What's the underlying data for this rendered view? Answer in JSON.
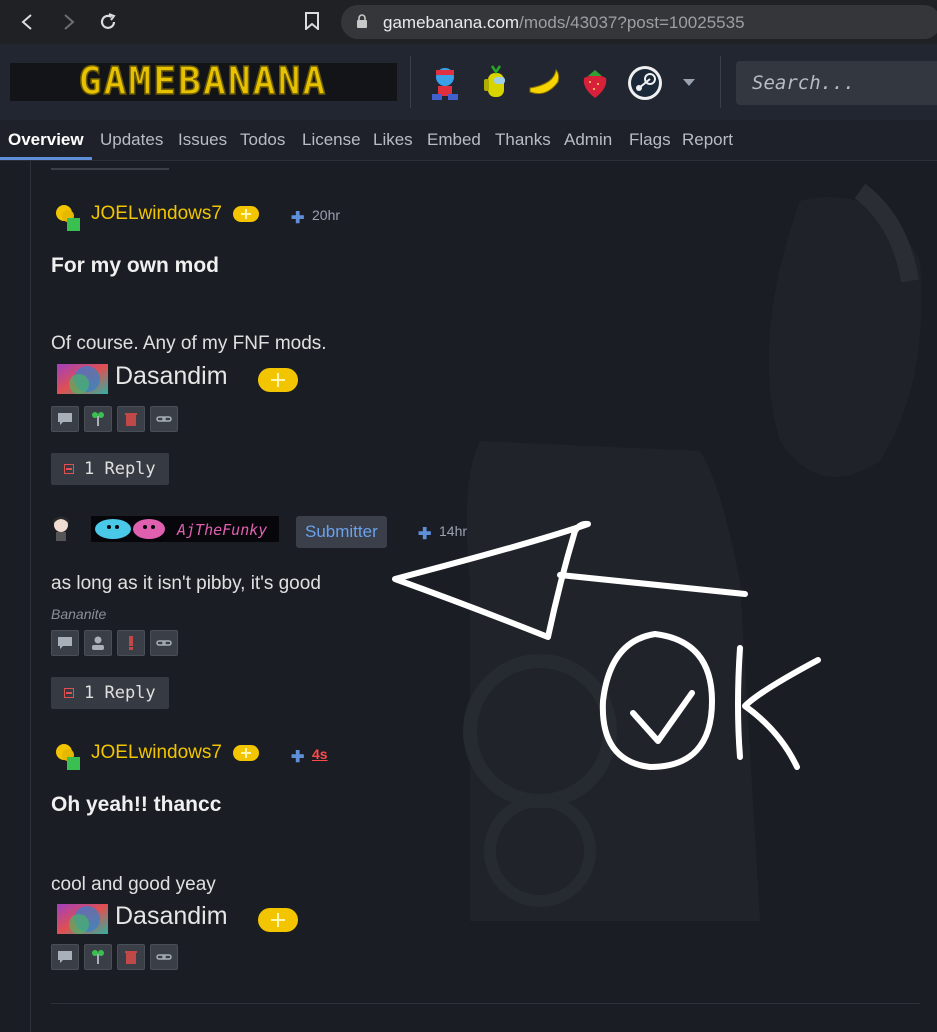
{
  "browser": {
    "url_host": "gamebanana.com",
    "url_path": "/mods/43037?post=10025535"
  },
  "site": {
    "logo_text": "GAMEBANANA",
    "game_icons": [
      "fnf-boyfriend-icon",
      "among-us-icon",
      "banana-icon",
      "strawberry-icon",
      "steam-icon"
    ],
    "search_placeholder": "Search..."
  },
  "tabs": [
    {
      "label": "Overview",
      "active": true
    },
    {
      "label": "Updates"
    },
    {
      "label": "Issues"
    },
    {
      "label": "Todos"
    },
    {
      "label": "License"
    },
    {
      "label": "Likes"
    },
    {
      "label": "Embed"
    },
    {
      "label": "Thanks"
    },
    {
      "label": "Admin"
    },
    {
      "label": "Flags"
    },
    {
      "label": "Report"
    }
  ],
  "posts": [
    {
      "username": "JOELwindows7",
      "time": "20hr",
      "title": "For my own mod",
      "body": "Of course. Any of my FNF mods.",
      "signature": "Dasandim",
      "reply_label": "1 Reply"
    },
    {
      "username": "AjTheFunky",
      "badge": "Submitter",
      "time": "14hr",
      "body": "as long as it isn't pibby, it's good",
      "rank": "Bananite",
      "reply_label": "1 Reply"
    },
    {
      "username": "JOELwindows7",
      "time": "4s",
      "title": "Oh yeah!! thancc",
      "body": "cool and good yeay",
      "signature": "Dasandim"
    }
  ],
  "colors": {
    "accent": "#5e8fd8",
    "username": "#f2c500",
    "new_time": "#ff4a4a"
  },
  "annotation": {
    "handwritten_text": "OK"
  }
}
